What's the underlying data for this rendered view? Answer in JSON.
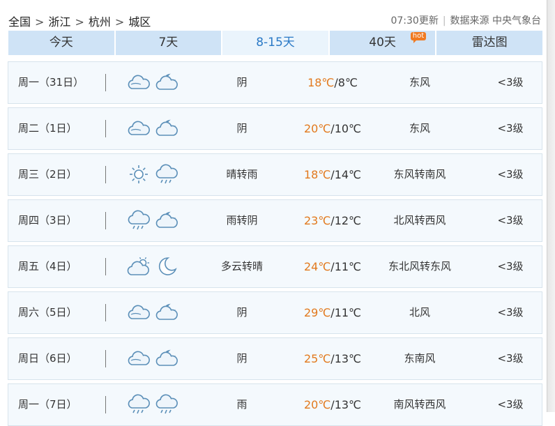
{
  "breadcrumb": [
    "全国",
    "浙江",
    "杭州",
    "城区"
  ],
  "breadcrumb_sep": ">",
  "update_time": "07:30更新",
  "data_source_label": "数据来源",
  "data_source": "中央气象台",
  "tabs": [
    {
      "label": "今天",
      "active": false
    },
    {
      "label": "7天",
      "active": false
    },
    {
      "label": "8-15天",
      "active": true
    },
    {
      "label": "40天",
      "active": false,
      "badge": "hot"
    },
    {
      "label": "雷达图",
      "active": false
    }
  ],
  "colors": {
    "accent": "#2a79c6",
    "high_temp": "#e2791d",
    "tab_bg": "#cfe3f6",
    "tab_active_bg": "#eaf4fc",
    "hot_badge": "#f07a22"
  },
  "days": [
    {
      "date": "周一（31日）",
      "day_icon": "cloudy-icon",
      "night_icon": "partly-cloudy-night-icon",
      "weather": "阴",
      "high": "18℃",
      "low": "/8℃",
      "wind": "东风",
      "level": "<3级"
    },
    {
      "date": "周二（1日）",
      "day_icon": "cloudy-icon",
      "night_icon": "partly-cloudy-night-icon",
      "weather": "阴",
      "high": "20℃",
      "low": "/10℃",
      "wind": "东风",
      "level": "<3级"
    },
    {
      "date": "周三（2日）",
      "day_icon": "sunny-icon",
      "night_icon": "rain-icon",
      "weather": "晴转雨",
      "high": "18℃",
      "low": "/14℃",
      "wind": "东风转南风",
      "level": "<3级"
    },
    {
      "date": "周四（3日）",
      "day_icon": "rain-icon",
      "night_icon": "partly-cloudy-night-icon",
      "weather": "雨转阴",
      "high": "23℃",
      "low": "/12℃",
      "wind": "北风转西风",
      "level": "<3级"
    },
    {
      "date": "周五（4日）",
      "day_icon": "partly-cloudy-day-icon",
      "night_icon": "moon-icon",
      "weather": "多云转晴",
      "high": "24℃",
      "low": "/11℃",
      "wind": "东北风转东风",
      "level": "<3级"
    },
    {
      "date": "周六（5日）",
      "day_icon": "cloudy-icon",
      "night_icon": "partly-cloudy-night-icon",
      "weather": "阴",
      "high": "29℃",
      "low": "/11℃",
      "wind": "北风",
      "level": "<3级"
    },
    {
      "date": "周日（6日）",
      "day_icon": "cloudy-icon",
      "night_icon": "partly-cloudy-night-icon",
      "weather": "阴",
      "high": "25℃",
      "low": "/13℃",
      "wind": "东南风",
      "level": "<3级"
    },
    {
      "date": "周一（7日）",
      "day_icon": "rain-icon",
      "night_icon": "rain-icon",
      "weather": "雨",
      "high": "20℃",
      "low": "/13℃",
      "wind": "南风转西风",
      "level": "<3级"
    }
  ]
}
